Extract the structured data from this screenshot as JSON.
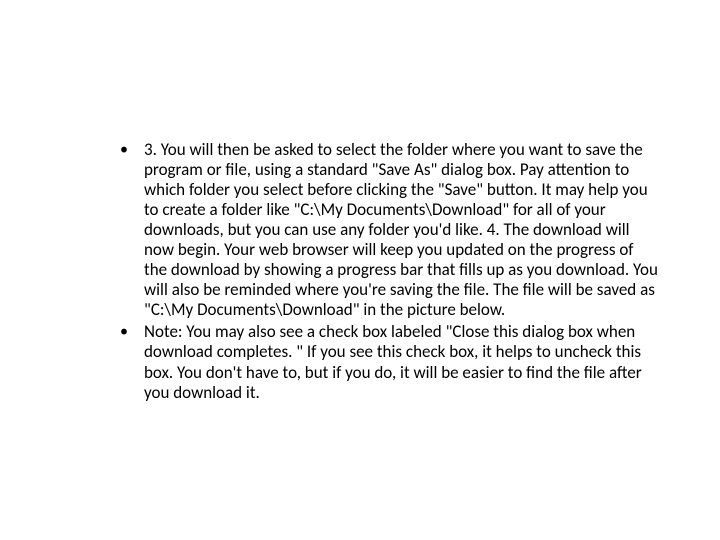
{
  "content": {
    "items": [
      {
        "text": "3. You will then be asked to select the folder where you want to save the program or file, using a standard \"Save As\" dialog box. Pay attention to which folder you select before clicking the \"Save\" button. It may help you to create a folder like \"C:\\My Documents\\Download\" for all of your downloads, but you can use any folder you'd like. 4. The download will now begin. Your web browser will keep you updated on the progress of the download by showing a progress bar that fills up as you download. You will also be reminded where you're saving the file. The file will be saved as \"C:\\My Documents\\Download\" in the picture below."
      },
      {
        "text": "Note: You may also see a check box labeled \"Close this dialog box when download completes. \" If you see this check box, it helps to uncheck this box. You don't have to, but if you do, it will be easier to find the file after you download it."
      }
    ]
  }
}
